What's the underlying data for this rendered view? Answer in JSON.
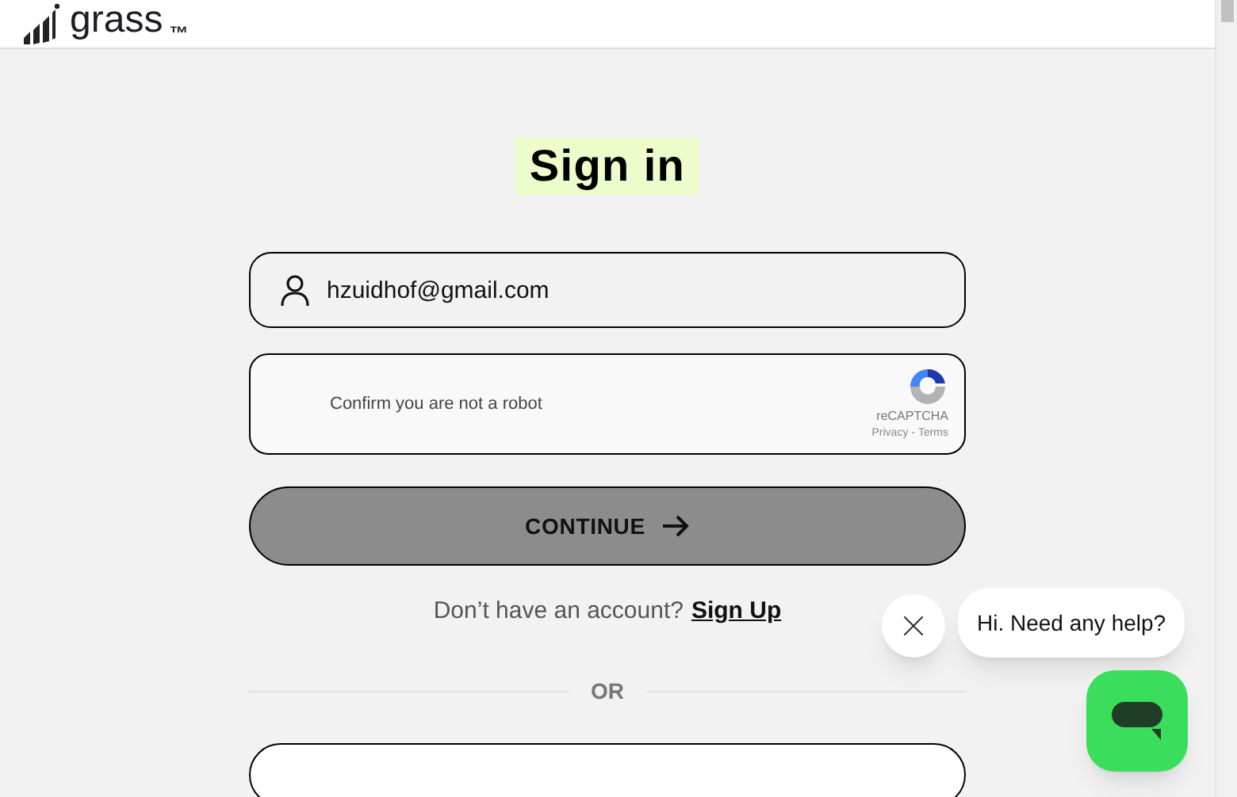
{
  "header": {
    "logo_text": "grass",
    "trademark": "™"
  },
  "title": "Sign in",
  "email_field": {
    "value": "hzuidhof@gmail.com"
  },
  "captcha": {
    "label": "Confirm you are not a robot",
    "brand": "reCAPTCHA",
    "privacy": "Privacy",
    "separator": " - ",
    "terms": "Terms"
  },
  "continue_button": {
    "label": "CONTINUE"
  },
  "signup_prompt": {
    "text": "Don’t have an account?",
    "link": "Sign Up"
  },
  "divider_label": "OR",
  "chat": {
    "message": "Hi. Need any help?"
  }
}
